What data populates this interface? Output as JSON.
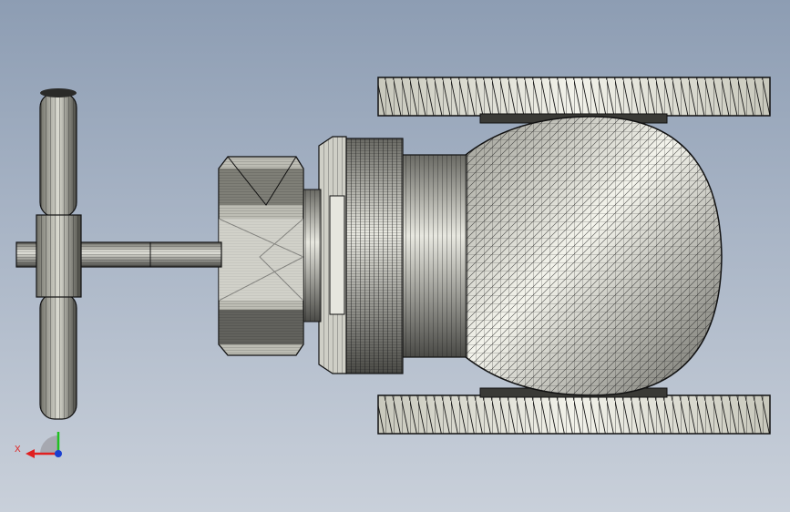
{
  "viewport": {
    "background_top": "#8d9db3",
    "background_bottom": "#c9d0da"
  },
  "model": {
    "parts": [
      "handwheel",
      "stem",
      "packing-nut",
      "bonnet",
      "body-ball",
      "flange-top",
      "flange-bottom"
    ],
    "mesh_color": "#1a1a1a",
    "surface_color": "#d8d8d0"
  },
  "triad": {
    "x_label": "X",
    "x_color": "#e02020",
    "y_color": "#20c020",
    "z_color": "#1a3fd0"
  }
}
